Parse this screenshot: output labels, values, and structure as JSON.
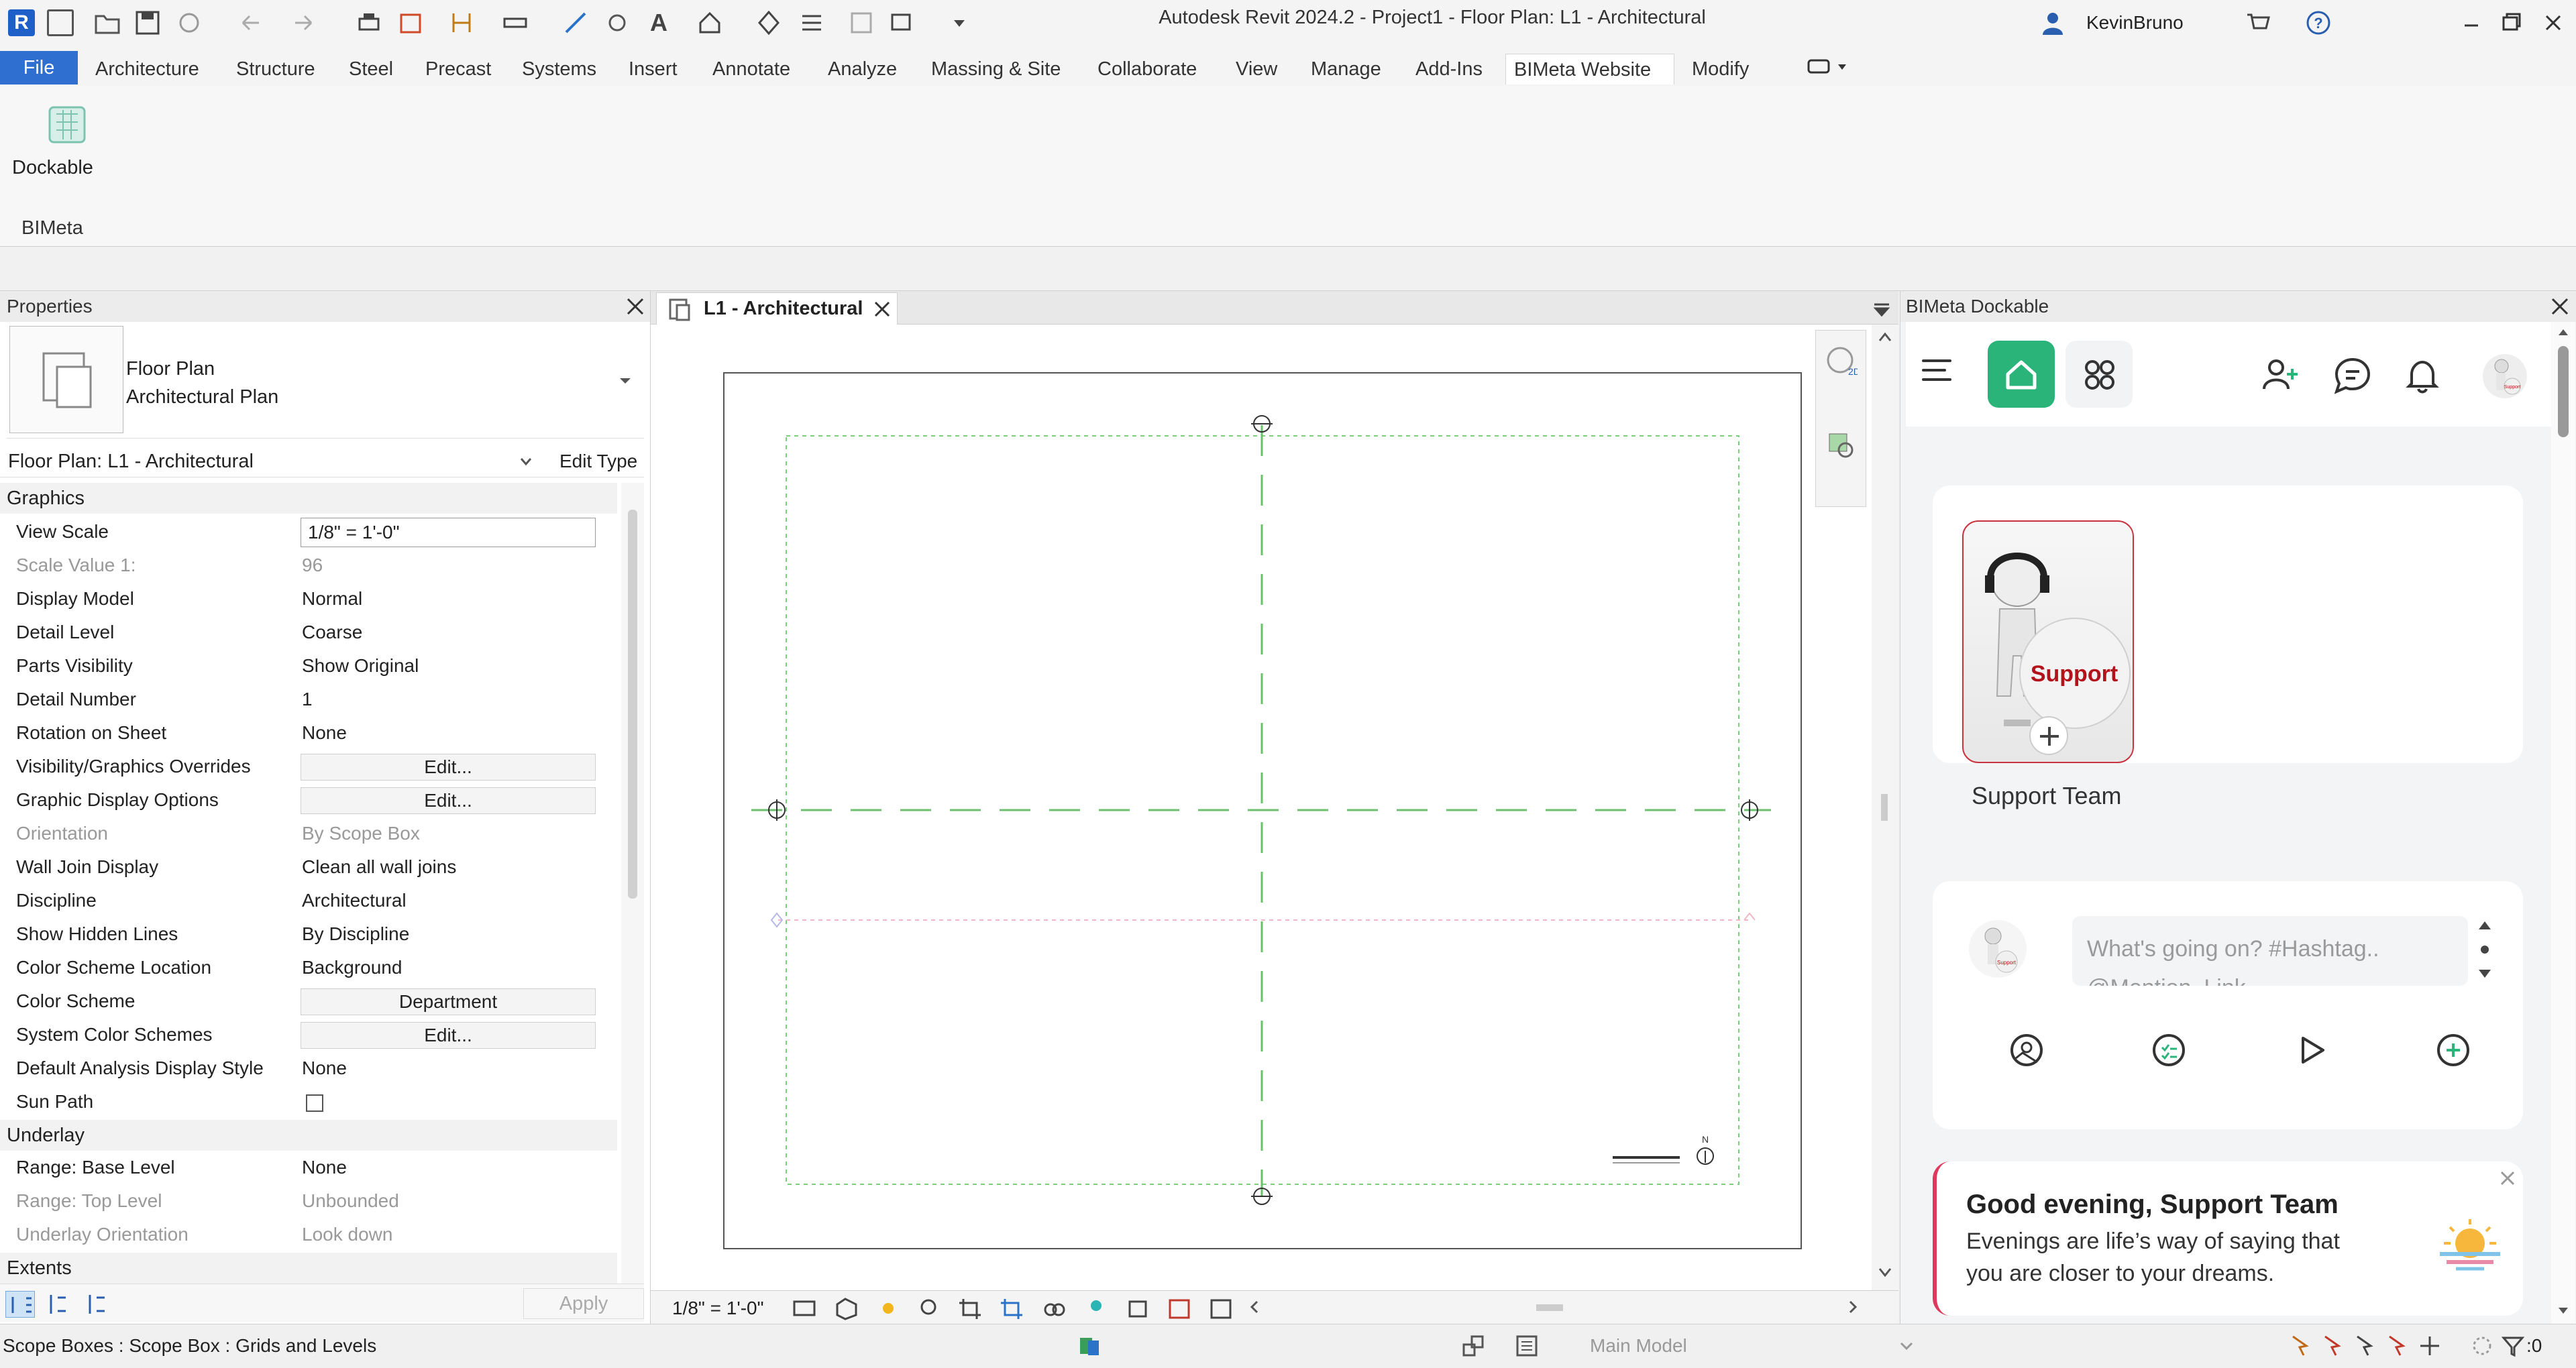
{
  "title_bar": {
    "app_title": "Autodesk Revit 2024.2 - Project1 - Floor Plan: L1 - Architectural",
    "user_name": "KevinBruno",
    "app_icon_letter": "R"
  },
  "ribbon": {
    "tabs": [
      {
        "label": "File"
      },
      {
        "label": "Architecture"
      },
      {
        "label": "Structure"
      },
      {
        "label": "Steel"
      },
      {
        "label": "Precast"
      },
      {
        "label": "Systems"
      },
      {
        "label": "Insert"
      },
      {
        "label": "Annotate"
      },
      {
        "label": "Analyze"
      },
      {
        "label": "Massing & Site"
      },
      {
        "label": "Collaborate"
      },
      {
        "label": "View"
      },
      {
        "label": "Manage"
      },
      {
        "label": "Add-Ins"
      },
      {
        "label": "BIMeta Website"
      },
      {
        "label": "Modify"
      }
    ],
    "active_tab": "BIMeta Website",
    "dockable_label": "Dockable",
    "panel_label": "BIMeta"
  },
  "properties": {
    "title": "Properties",
    "type_name": "Floor Plan",
    "type_subname": "Architectural Plan",
    "instance_selector": "Floor Plan: L1 - Architectural",
    "edit_type": "Edit Type",
    "sections": {
      "graphics": "Graphics",
      "underlay": "Underlay",
      "extents": "Extents"
    },
    "rows": [
      {
        "name": "View Scale",
        "value": "1/8\" = 1'-0\""
      },
      {
        "name": "Scale Value    1:",
        "value": "96"
      },
      {
        "name": "Display Model",
        "value": "Normal"
      },
      {
        "name": "Detail Level",
        "value": "Coarse"
      },
      {
        "name": "Parts Visibility",
        "value": "Show Original"
      },
      {
        "name": "Detail Number",
        "value": "1"
      },
      {
        "name": "Rotation on Sheet",
        "value": "None"
      },
      {
        "name": "Visibility/Graphics Overrides",
        "value": "Edit..."
      },
      {
        "name": "Graphic Display Options",
        "value": "Edit..."
      },
      {
        "name": "Orientation",
        "value": "By Scope Box"
      },
      {
        "name": "Wall Join Display",
        "value": "Clean all wall joins"
      },
      {
        "name": "Discipline",
        "value": "Architectural"
      },
      {
        "name": "Show Hidden Lines",
        "value": "By Discipline"
      },
      {
        "name": "Color Scheme Location",
        "value": "Background"
      },
      {
        "name": "Color Scheme",
        "value": "Department"
      },
      {
        "name": "System Color Schemes",
        "value": "Edit..."
      },
      {
        "name": "Default Analysis Display Style",
        "value": "None"
      },
      {
        "name": "Sun Path",
        "value": ""
      }
    ],
    "underlay_rows": [
      {
        "name": "Range: Base Level",
        "value": "None"
      },
      {
        "name": "Range: Top Level",
        "value": "Unbounded"
      },
      {
        "name": "Underlay Orientation",
        "value": "Look down"
      }
    ],
    "apply": "Apply"
  },
  "view": {
    "tab_label": "L1 - Architectural",
    "scale": "1/8\" = 1'-0\"",
    "north_label": "N"
  },
  "dock": {
    "title": "BIMeta Dockable",
    "support_card": {
      "name": "Support Team",
      "badge_text": "Support"
    },
    "post_placeholder": "What's going on? #Hashtag..",
    "post_placeholder_2": "@Mention. Link..",
    "greeting_title": "Good evening, Support Team",
    "greeting_text_1": "Evenings are life’s way of saying that",
    "greeting_text_2": "you are closer to your dreams.",
    "accent": "#2bb47a"
  },
  "status_bar": {
    "text": "Scope Boxes : Scope Box : Grids and Levels",
    "model": "Main Model",
    "filter_count": ":0"
  }
}
